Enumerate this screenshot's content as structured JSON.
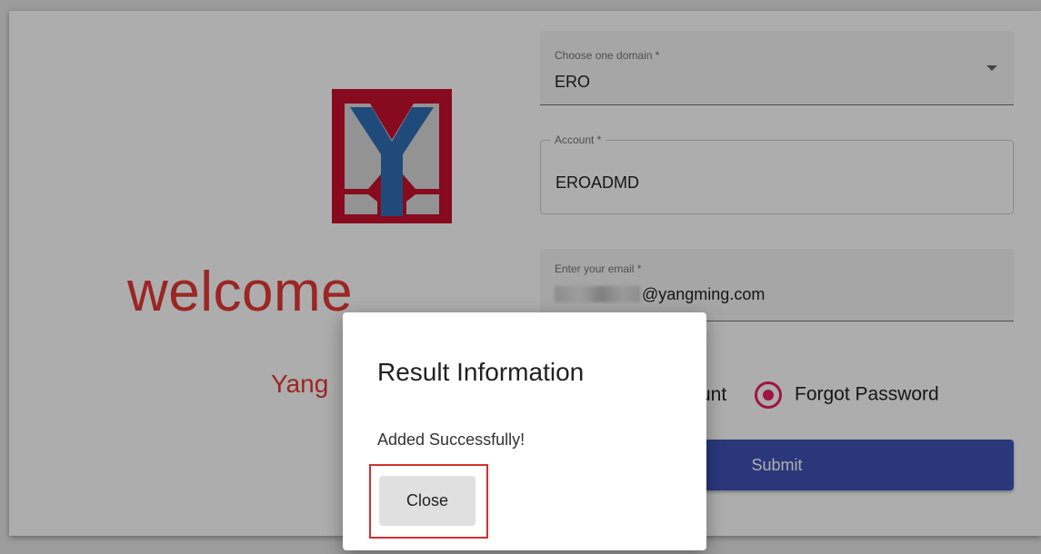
{
  "colors": {
    "brand_red": "#e53935",
    "logo_blue": "#2e6db4",
    "primary": "#3f51b5",
    "radio_accent": "#e91e63",
    "highlight_box": "#d32f2f"
  },
  "branding": {
    "logo_icon": "yangming-logo",
    "welcome": "welcome",
    "subtitle": "Yang"
  },
  "form": {
    "domain": {
      "label": "Choose one domain *",
      "value": "ERO",
      "icon": "chevron-down-icon"
    },
    "account": {
      "label": "Account *",
      "value": "EROADMD"
    },
    "email": {
      "label": "Enter your email *",
      "value_visible": "@yangming.com"
    },
    "radio": {
      "option1_label": "unt",
      "option2_label": "Forgot Password",
      "selected": "Forgot Password"
    },
    "submit_label": "Submit"
  },
  "dialog": {
    "title": "Result Information",
    "message": "Added Successfully!",
    "close_label": "Close"
  }
}
